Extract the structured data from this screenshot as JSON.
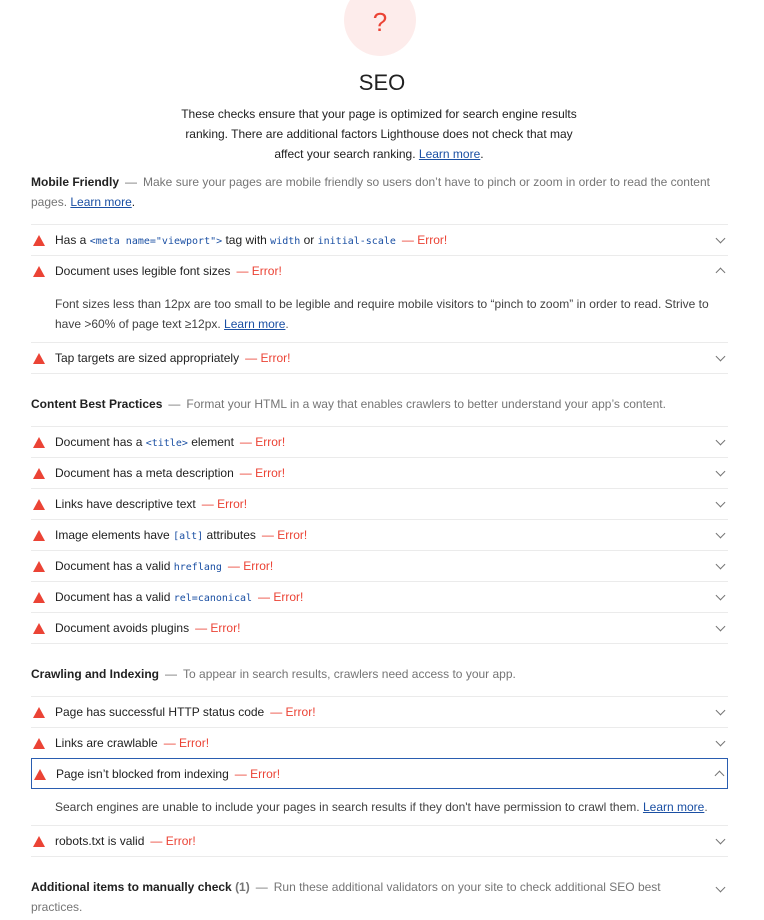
{
  "category": {
    "icon_glyph": "?",
    "icon": "question-mark-icon",
    "title": "SEO",
    "description": "These checks ensure that your page is optimized for search engine results ranking. There are additional factors Lighthouse does not check that may affect your search ranking.",
    "learn_more": "Learn more"
  },
  "error_label": "— Error!",
  "groups": {
    "mobile": {
      "title": "Mobile Friendly",
      "dash": "—",
      "description": "Make sure your pages are mobile friendly so users don’t have to pinch or zoom in order to read the content pages.",
      "learn_more": "Learn more"
    },
    "content": {
      "title": "Content Best Practices",
      "dash": "—",
      "description": "Format your HTML in a way that enables crawlers to better understand your app’s content."
    },
    "crawling": {
      "title": "Crawling and Indexing",
      "dash": "—",
      "description": "To appear in search results, crawlers need access to your app."
    },
    "manual": {
      "title": "Additional items to manually check",
      "count": "(1)",
      "dash": "—",
      "description": "Run these additional validators on your site to check additional SEO best practices."
    }
  },
  "audits": {
    "viewport": {
      "pre": "Has a ",
      "code1": "<meta name=\"viewport\">",
      "mid": " tag with ",
      "code2": "width",
      "or": " or ",
      "code3": "initial-scale"
    },
    "font_size": {
      "title": "Document uses legible font sizes",
      "detail": "Font sizes less than 12px are too small to be legible and require mobile visitors to “pinch to zoom” in order to read. Strive to have >60% of page text ≥12px.",
      "learn_more": "Learn more"
    },
    "tap_targets": {
      "title": "Tap targets are sized appropriately"
    },
    "doc_title": {
      "pre": "Document has a ",
      "code": "<title>",
      "post": " element"
    },
    "meta_desc": {
      "title": "Document has a meta description"
    },
    "link_text": {
      "title": "Links have descriptive text"
    },
    "image_alt": {
      "pre": "Image elements have ",
      "code": "[alt]",
      "post": " attributes"
    },
    "hreflang": {
      "pre": "Document has a valid ",
      "code": "hreflang"
    },
    "canonical": {
      "pre": "Document has a valid ",
      "code": "rel=canonical"
    },
    "plugins": {
      "title": "Document avoids plugins"
    },
    "http_status": {
      "title": "Page has successful HTTP status code"
    },
    "crawlable": {
      "title": "Links are crawlable"
    },
    "is_crawlable": {
      "title": "Page isn’t blocked from indexing",
      "detail": "Search engines are unable to include your pages in search results if they don't have permission to crawl them.",
      "learn_more": "Learn more"
    },
    "robots": {
      "title": "robots.txt is valid"
    }
  },
  "colors": {
    "fail": "#eb4335",
    "link": "#1a4fa3",
    "selected_border": "#2a5db0"
  }
}
